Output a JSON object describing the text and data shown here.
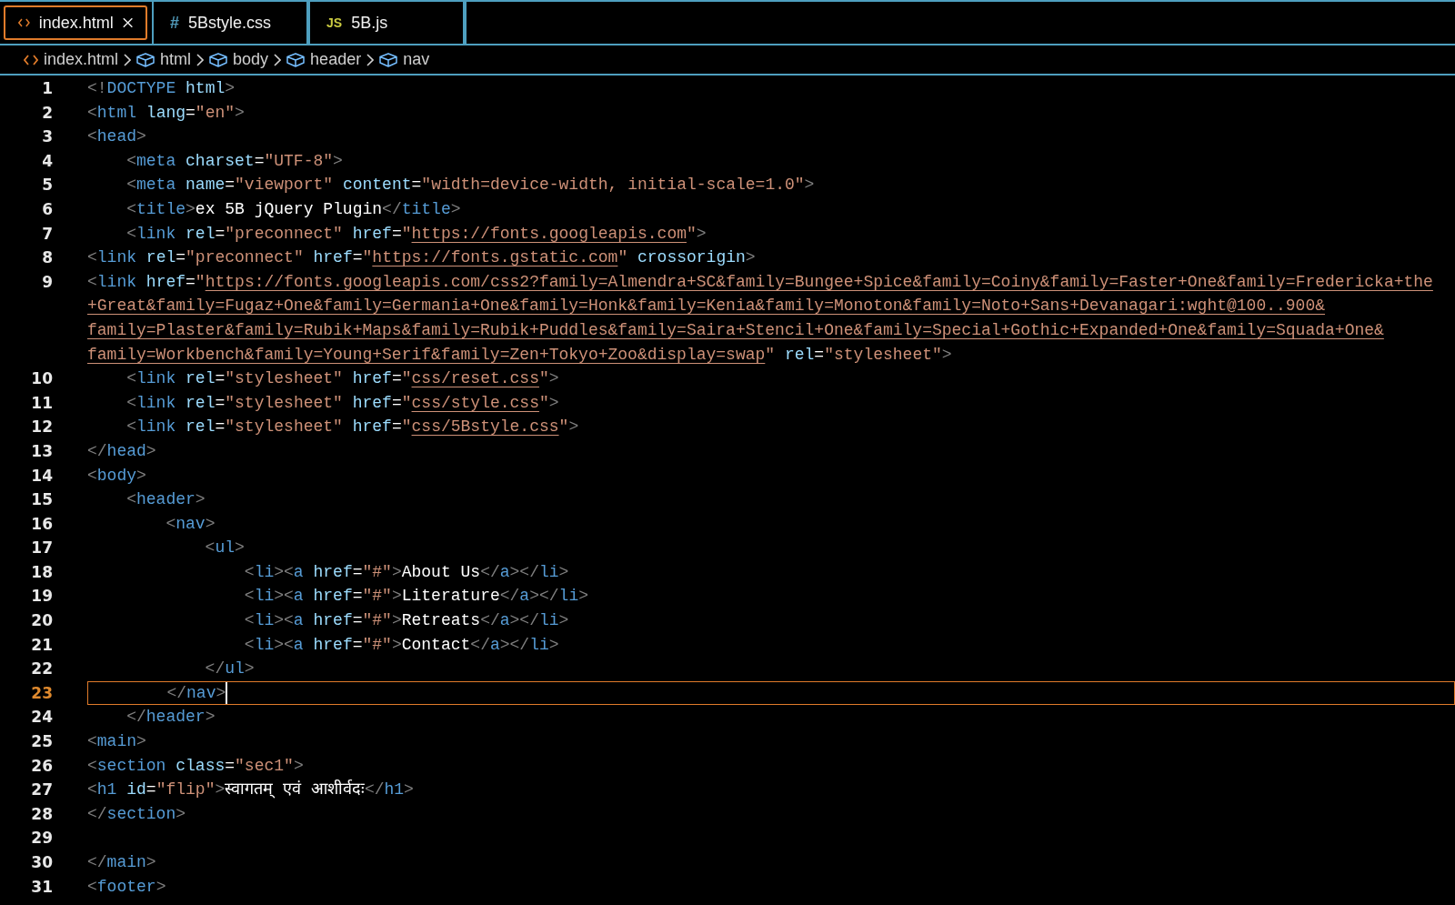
{
  "tabs": [
    {
      "label": "index.html",
      "kind": "html",
      "selected": true
    },
    {
      "label": "5Bstyle.css",
      "kind": "css",
      "icon_text": "#",
      "selected": false
    },
    {
      "label": "5B.js",
      "kind": "js",
      "icon_text": "JS",
      "selected": false
    }
  ],
  "breadcrumb": [
    {
      "label": "index.html",
      "kind": "file"
    },
    {
      "label": "html",
      "kind": "element"
    },
    {
      "label": "body",
      "kind": "element"
    },
    {
      "label": "header",
      "kind": "element"
    },
    {
      "label": "nav",
      "kind": "element"
    }
  ],
  "lines": [
    {
      "number": "1",
      "current": false,
      "tokens": [
        {
          "kind": "p",
          "text": "<!"
        },
        {
          "kind": "tag",
          "text": "DOCTYPE"
        },
        {
          "kind": "attr",
          "text": " html"
        },
        {
          "kind": "p",
          "text": ">"
        }
      ]
    },
    {
      "number": "2",
      "current": false,
      "tokens": [
        {
          "kind": "p",
          "text": "<"
        },
        {
          "kind": "tag",
          "text": "html"
        },
        {
          "kind": "attr",
          "text": " lang"
        },
        {
          "kind": "text",
          "text": "="
        },
        {
          "kind": "str",
          "text": "\"en\""
        },
        {
          "kind": "p",
          "text": ">"
        }
      ]
    },
    {
      "number": "3",
      "current": false,
      "tokens": [
        {
          "kind": "p",
          "text": "<"
        },
        {
          "kind": "tag",
          "text": "head"
        },
        {
          "kind": "p",
          "text": ">"
        }
      ]
    },
    {
      "number": "4",
      "current": false,
      "tokens": [
        {
          "kind": "p",
          "text": "    <"
        },
        {
          "kind": "tag",
          "text": "meta"
        },
        {
          "kind": "attr",
          "text": " charset"
        },
        {
          "kind": "text",
          "text": "="
        },
        {
          "kind": "str",
          "text": "\"UTF-8\""
        },
        {
          "kind": "p",
          "text": ">"
        }
      ]
    },
    {
      "number": "5",
      "current": false,
      "tokens": [
        {
          "kind": "p",
          "text": "    <"
        },
        {
          "kind": "tag",
          "text": "meta"
        },
        {
          "kind": "attr",
          "text": " name"
        },
        {
          "kind": "text",
          "text": "="
        },
        {
          "kind": "str",
          "text": "\"viewport\""
        },
        {
          "kind": "attr",
          "text": " content"
        },
        {
          "kind": "text",
          "text": "="
        },
        {
          "kind": "str",
          "text": "\"width=device-width, initial-scale=1.0\""
        },
        {
          "kind": "p",
          "text": ">"
        }
      ]
    },
    {
      "number": "6",
      "current": false,
      "tokens": [
        {
          "kind": "p",
          "text": "    <"
        },
        {
          "kind": "tag",
          "text": "title"
        },
        {
          "kind": "p",
          "text": ">"
        },
        {
          "kind": "text",
          "text": "ex 5B jQuery Plugin"
        },
        {
          "kind": "p",
          "text": "</"
        },
        {
          "kind": "tag",
          "text": "title"
        },
        {
          "kind": "p",
          "text": ">"
        }
      ]
    },
    {
      "number": "7",
      "current": false,
      "tokens": [
        {
          "kind": "p",
          "text": "    <"
        },
        {
          "kind": "tag",
          "text": "link"
        },
        {
          "kind": "attr",
          "text": " rel"
        },
        {
          "kind": "text",
          "text": "="
        },
        {
          "kind": "str",
          "text": "\"preconnect\""
        },
        {
          "kind": "attr",
          "text": " href"
        },
        {
          "kind": "text",
          "text": "="
        },
        {
          "kind": "str",
          "text": "\""
        },
        {
          "kind": "url",
          "text": "https://fonts.googleapis.com"
        },
        {
          "kind": "str",
          "text": "\""
        },
        {
          "kind": "p",
          "text": ">"
        }
      ]
    },
    {
      "number": "8",
      "current": false,
      "tokens": [
        {
          "kind": "p",
          "text": "<"
        },
        {
          "kind": "tag",
          "text": "link"
        },
        {
          "kind": "attr",
          "text": " rel"
        },
        {
          "kind": "text",
          "text": "="
        },
        {
          "kind": "str",
          "text": "\"preconnect\""
        },
        {
          "kind": "attr",
          "text": " href"
        },
        {
          "kind": "text",
          "text": "="
        },
        {
          "kind": "str",
          "text": "\""
        },
        {
          "kind": "url",
          "text": "https://fonts.gstatic.com"
        },
        {
          "kind": "str",
          "text": "\""
        },
        {
          "kind": "attr",
          "text": " crossorigin"
        },
        {
          "kind": "p",
          "text": ">"
        }
      ]
    },
    {
      "number": "9",
      "current": false,
      "tokens": [
        {
          "kind": "p",
          "text": "<"
        },
        {
          "kind": "tag",
          "text": "link"
        },
        {
          "kind": "attr",
          "text": " href"
        },
        {
          "kind": "text",
          "text": "="
        },
        {
          "kind": "str",
          "text": "\""
        },
        {
          "kind": "url",
          "text": "https://fonts.googleapis.com/css2?family=Almendra+SC&family=Bungee+Spice&family=Coiny&family=Faster+One&family=Fredericka+the"
        }
      ],
      "continuation": [
        {
          "tokens": [
            {
              "kind": "url",
              "text": "+Great&family=Fugaz+One&family=Germania+One&family=Honk&family=Kenia&family=Monoton&family=Noto+Sans+Devanagari:wght@100..900&"
            }
          ]
        },
        {
          "tokens": [
            {
              "kind": "url",
              "text": "family=Plaster&family=Rubik+Maps&family=Rubik+Puddles&family=Saira+Stencil+One&family=Special+Gothic+Expanded+One&family=Squada+One&"
            }
          ]
        },
        {
          "tokens": [
            {
              "kind": "url",
              "text": "family=Workbench&family=Young+Serif&family=Zen+Tokyo+Zoo&display=swap"
            },
            {
              "kind": "str",
              "text": "\""
            },
            {
              "kind": "attr",
              "text": " rel"
            },
            {
              "kind": "text",
              "text": "="
            },
            {
              "kind": "str",
              "text": "\"stylesheet\""
            },
            {
              "kind": "p",
              "text": ">"
            }
          ]
        }
      ]
    },
    {
      "number": "10",
      "current": false,
      "tokens": [
        {
          "kind": "p",
          "text": "    <"
        },
        {
          "kind": "tag",
          "text": "link"
        },
        {
          "kind": "attr",
          "text": " rel"
        },
        {
          "kind": "text",
          "text": "="
        },
        {
          "kind": "str",
          "text": "\"stylesheet\""
        },
        {
          "kind": "attr",
          "text": " href"
        },
        {
          "kind": "text",
          "text": "="
        },
        {
          "kind": "str",
          "text": "\""
        },
        {
          "kind": "url",
          "text": "css/reset.css"
        },
        {
          "kind": "str",
          "text": "\""
        },
        {
          "kind": "p",
          "text": ">"
        }
      ]
    },
    {
      "number": "11",
      "current": false,
      "tokens": [
        {
          "kind": "p",
          "text": "    <"
        },
        {
          "kind": "tag",
          "text": "link"
        },
        {
          "kind": "attr",
          "text": " rel"
        },
        {
          "kind": "text",
          "text": "="
        },
        {
          "kind": "str",
          "text": "\"stylesheet\""
        },
        {
          "kind": "attr",
          "text": " href"
        },
        {
          "kind": "text",
          "text": "="
        },
        {
          "kind": "str",
          "text": "\""
        },
        {
          "kind": "url",
          "text": "css/style.css"
        },
        {
          "kind": "str",
          "text": "\""
        },
        {
          "kind": "p",
          "text": ">"
        }
      ]
    },
    {
      "number": "12",
      "current": false,
      "tokens": [
        {
          "kind": "p",
          "text": "    <"
        },
        {
          "kind": "tag",
          "text": "link"
        },
        {
          "kind": "attr",
          "text": " rel"
        },
        {
          "kind": "text",
          "text": "="
        },
        {
          "kind": "str",
          "text": "\"stylesheet\""
        },
        {
          "kind": "attr",
          "text": " href"
        },
        {
          "kind": "text",
          "text": "="
        },
        {
          "kind": "str",
          "text": "\""
        },
        {
          "kind": "url",
          "text": "css/5Bstyle.css"
        },
        {
          "kind": "str",
          "text": "\""
        },
        {
          "kind": "p",
          "text": ">"
        }
      ]
    },
    {
      "number": "13",
      "current": false,
      "tokens": [
        {
          "kind": "p",
          "text": "</"
        },
        {
          "kind": "tag",
          "text": "head"
        },
        {
          "kind": "p",
          "text": ">"
        }
      ]
    },
    {
      "number": "14",
      "current": false,
      "tokens": [
        {
          "kind": "p",
          "text": "<"
        },
        {
          "kind": "tag",
          "text": "body"
        },
        {
          "kind": "p",
          "text": ">"
        }
      ]
    },
    {
      "number": "15",
      "current": false,
      "tokens": [
        {
          "kind": "p",
          "text": "    <"
        },
        {
          "kind": "tag",
          "text": "header"
        },
        {
          "kind": "p",
          "text": ">"
        }
      ]
    },
    {
      "number": "16",
      "current": false,
      "tokens": [
        {
          "kind": "p",
          "text": "        <"
        },
        {
          "kind": "tag",
          "text": "nav"
        },
        {
          "kind": "p",
          "text": ">"
        }
      ]
    },
    {
      "number": "17",
      "current": false,
      "tokens": [
        {
          "kind": "p",
          "text": "            <"
        },
        {
          "kind": "tag",
          "text": "ul"
        },
        {
          "kind": "p",
          "text": ">"
        }
      ]
    },
    {
      "number": "18",
      "current": false,
      "tokens": [
        {
          "kind": "p",
          "text": "                <"
        },
        {
          "kind": "tag",
          "text": "li"
        },
        {
          "kind": "p",
          "text": "><"
        },
        {
          "kind": "tag",
          "text": "a"
        },
        {
          "kind": "attr",
          "text": " href"
        },
        {
          "kind": "text",
          "text": "="
        },
        {
          "kind": "str",
          "text": "\"#\""
        },
        {
          "kind": "p",
          "text": ">"
        },
        {
          "kind": "text",
          "text": "About Us"
        },
        {
          "kind": "p",
          "text": "</"
        },
        {
          "kind": "tag",
          "text": "a"
        },
        {
          "kind": "p",
          "text": "></"
        },
        {
          "kind": "tag",
          "text": "li"
        },
        {
          "kind": "p",
          "text": ">"
        }
      ]
    },
    {
      "number": "19",
      "current": false,
      "tokens": [
        {
          "kind": "p",
          "text": "                <"
        },
        {
          "kind": "tag",
          "text": "li"
        },
        {
          "kind": "p",
          "text": "><"
        },
        {
          "kind": "tag",
          "text": "a"
        },
        {
          "kind": "attr",
          "text": " href"
        },
        {
          "kind": "text",
          "text": "="
        },
        {
          "kind": "str",
          "text": "\"#\""
        },
        {
          "kind": "p",
          "text": ">"
        },
        {
          "kind": "text",
          "text": "Literature"
        },
        {
          "kind": "p",
          "text": "</"
        },
        {
          "kind": "tag",
          "text": "a"
        },
        {
          "kind": "p",
          "text": "></"
        },
        {
          "kind": "tag",
          "text": "li"
        },
        {
          "kind": "p",
          "text": ">"
        }
      ]
    },
    {
      "number": "20",
      "current": false,
      "tokens": [
        {
          "kind": "p",
          "text": "                <"
        },
        {
          "kind": "tag",
          "text": "li"
        },
        {
          "kind": "p",
          "text": "><"
        },
        {
          "kind": "tag",
          "text": "a"
        },
        {
          "kind": "attr",
          "text": " href"
        },
        {
          "kind": "text",
          "text": "="
        },
        {
          "kind": "str",
          "text": "\"#\""
        },
        {
          "kind": "p",
          "text": ">"
        },
        {
          "kind": "text",
          "text": "Retreats"
        },
        {
          "kind": "p",
          "text": "</"
        },
        {
          "kind": "tag",
          "text": "a"
        },
        {
          "kind": "p",
          "text": "></"
        },
        {
          "kind": "tag",
          "text": "li"
        },
        {
          "kind": "p",
          "text": ">"
        }
      ]
    },
    {
      "number": "21",
      "current": false,
      "tokens": [
        {
          "kind": "p",
          "text": "                <"
        },
        {
          "kind": "tag",
          "text": "li"
        },
        {
          "kind": "p",
          "text": "><"
        },
        {
          "kind": "tag",
          "text": "a"
        },
        {
          "kind": "attr",
          "text": " href"
        },
        {
          "kind": "text",
          "text": "="
        },
        {
          "kind": "str",
          "text": "\"#\""
        },
        {
          "kind": "p",
          "text": ">"
        },
        {
          "kind": "text",
          "text": "Contact"
        },
        {
          "kind": "p",
          "text": "</"
        },
        {
          "kind": "tag",
          "text": "a"
        },
        {
          "kind": "p",
          "text": "></"
        },
        {
          "kind": "tag",
          "text": "li"
        },
        {
          "kind": "p",
          "text": ">"
        }
      ]
    },
    {
      "number": "22",
      "current": false,
      "tokens": [
        {
          "kind": "p",
          "text": "            </"
        },
        {
          "kind": "tag",
          "text": "ul"
        },
        {
          "kind": "p",
          "text": ">"
        }
      ]
    },
    {
      "number": "23",
      "current": true,
      "tokens": [
        {
          "kind": "p",
          "text": "        </"
        },
        {
          "kind": "tag",
          "text": "nav"
        },
        {
          "kind": "p",
          "text": ">"
        }
      ]
    },
    {
      "number": "24",
      "current": false,
      "tokens": [
        {
          "kind": "p",
          "text": "    </"
        },
        {
          "kind": "tag",
          "text": "header"
        },
        {
          "kind": "p",
          "text": ">"
        }
      ]
    },
    {
      "number": "25",
      "current": false,
      "tokens": [
        {
          "kind": "p",
          "text": "<"
        },
        {
          "kind": "tag",
          "text": "main"
        },
        {
          "kind": "p",
          "text": ">"
        }
      ]
    },
    {
      "number": "26",
      "current": false,
      "tokens": [
        {
          "kind": "p",
          "text": "<"
        },
        {
          "kind": "tag",
          "text": "section"
        },
        {
          "kind": "attr",
          "text": " class"
        },
        {
          "kind": "text",
          "text": "="
        },
        {
          "kind": "str",
          "text": "\"sec1\""
        },
        {
          "kind": "p",
          "text": ">"
        }
      ]
    },
    {
      "number": "27",
      "current": false,
      "tokens": [
        {
          "kind": "p",
          "text": "<"
        },
        {
          "kind": "tag",
          "text": "h1"
        },
        {
          "kind": "attr",
          "text": " id"
        },
        {
          "kind": "text",
          "text": "="
        },
        {
          "kind": "str",
          "text": "\"flip\""
        },
        {
          "kind": "p",
          "text": ">"
        },
        {
          "kind": "text",
          "text": "स्वागतम् एवं आशीर्वदः"
        },
        {
          "kind": "p",
          "text": "</"
        },
        {
          "kind": "tag",
          "text": "h1"
        },
        {
          "kind": "p",
          "text": ">"
        }
      ]
    },
    {
      "number": "28",
      "current": false,
      "tokens": [
        {
          "kind": "p",
          "text": "</"
        },
        {
          "kind": "tag",
          "text": "section"
        },
        {
          "kind": "p",
          "text": ">"
        }
      ]
    },
    {
      "number": "29",
      "current": false
    },
    {
      "number": "30",
      "current": false,
      "tokens": [
        {
          "kind": "p",
          "text": "</"
        },
        {
          "kind": "tag",
          "text": "main"
        },
        {
          "kind": "p",
          "text": ">"
        }
      ]
    },
    {
      "number": "31",
      "current": false,
      "tokens": [
        {
          "kind": "p",
          "text": "<"
        },
        {
          "kind": "tag",
          "text": "footer"
        },
        {
          "kind": "p",
          "text": ">"
        }
      ]
    }
  ]
}
